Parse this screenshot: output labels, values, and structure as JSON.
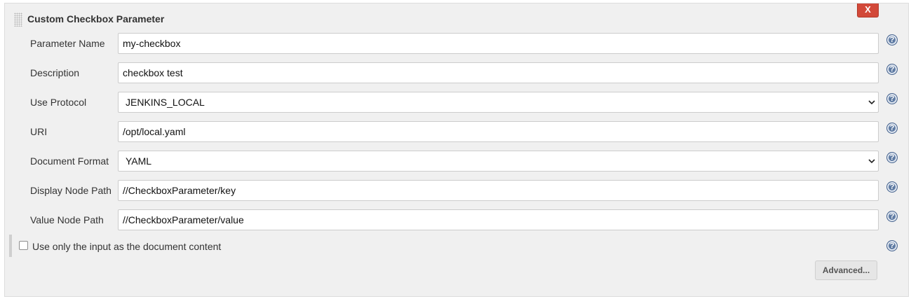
{
  "section": {
    "title": "Custom Checkbox Parameter",
    "delete_label": "X"
  },
  "fields": [
    {
      "label": "Parameter Name",
      "value": "my-checkbox",
      "kind": "text"
    },
    {
      "label": "Description",
      "value": "checkbox test",
      "kind": "text"
    },
    {
      "label": "Use Protocol",
      "value": "JENKINS_LOCAL",
      "kind": "select"
    },
    {
      "label": "URI",
      "value": "/opt/local.yaml",
      "kind": "text"
    },
    {
      "label": "Document Format",
      "value": "YAML",
      "kind": "select"
    },
    {
      "label": "Display Node Path",
      "value": "//CheckboxParameter/key",
      "kind": "text"
    },
    {
      "label": "Value Node Path",
      "value": "//CheckboxParameter/value",
      "kind": "text"
    }
  ],
  "checkbox": {
    "label": "Use only the input as the document content",
    "checked": false
  },
  "help_icon": {
    "glyph": "?",
    "icon": "help-icon"
  },
  "advanced_label": "Advanced...",
  "colors": {
    "panel_bg": "#f0f0f0",
    "delete_bg": "#d24939",
    "help_bg": "#5f7ba3"
  }
}
